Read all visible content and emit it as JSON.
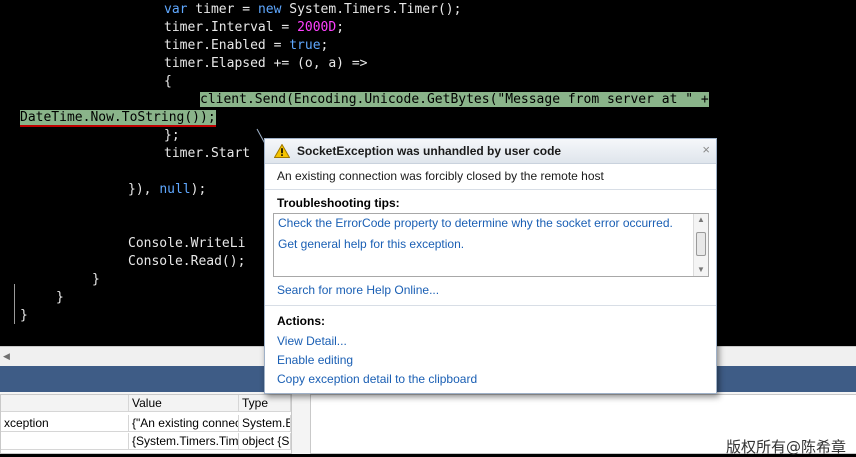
{
  "code": {
    "line1": {
      "kw": "var",
      "mid": " timer = ",
      "kw2": "new",
      "rest": " System.Timers.Timer();"
    },
    "line2": {
      "pre": "timer.Interval = ",
      "num": "2000D",
      "post": ";"
    },
    "line3": {
      "pre": "timer.Enabled = ",
      "kw": "true",
      "post": ";"
    },
    "line4": "timer.Elapsed += (o, a) =>",
    "line5": "{",
    "line6": "client.Send(Encoding.Unicode.GetBytes(\"Message from server at \" +",
    "line7": "DateTime.Now.ToString());",
    "line8": "};",
    "line9": "timer.Start",
    "line10": {
      "pre": "}), ",
      "kw": "null",
      "post": ");"
    },
    "line11": "Console.WriteLi",
    "line12": "Console.Read();",
    "line13": "}",
    "line14": "}",
    "line15": "}"
  },
  "exception_assistant": {
    "title": "SocketException was unhandled by user code",
    "message": "An existing connection was forcibly closed by the remote host",
    "tips_title": "Troubleshooting tips:",
    "tips": [
      "Check the ErrorCode property to determine why the socket error occurred.",
      "Get general help for this exception."
    ],
    "search_link": "Search for more Help Online...",
    "actions_title": "Actions:",
    "actions": [
      "View Detail...",
      "Enable editing",
      "Copy exception detail to the clipboard"
    ],
    "close": "×"
  },
  "locals": {
    "headers": {
      "value": "Value",
      "type": "Type"
    },
    "rows": [
      {
        "name": "xception",
        "value": "{\"An existing connec",
        "type": "System.E"
      },
      {
        "name": "",
        "value": "{System.Timers.Tim",
        "type": "object {S"
      }
    ]
  },
  "watermark": "版权所有@陈希章",
  "colors": {
    "keyword": "#5fa8ff",
    "number": "#ff40ff",
    "highlight": "#8ab48a",
    "link": "#1a5fb4",
    "toolstrip": "#3e5c86"
  },
  "icons": {
    "warning": "warning-icon",
    "close": "close-icon"
  }
}
